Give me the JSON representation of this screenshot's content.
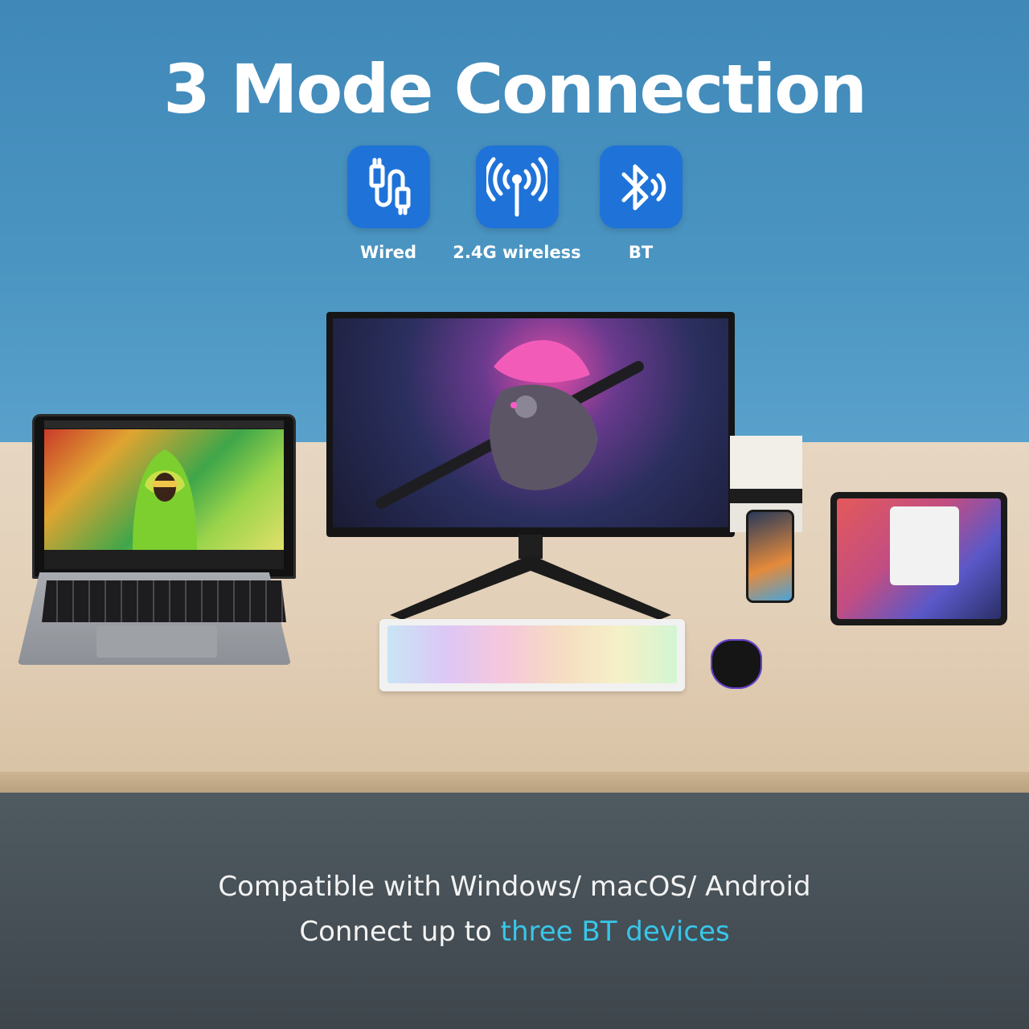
{
  "title": "3 Mode Connection",
  "modes": [
    {
      "label": "Wired",
      "icon": "usb-cable-icon"
    },
    {
      "label": "2.4G wireless",
      "icon": "wireless-signal-icon"
    },
    {
      "label": "BT",
      "icon": "bluetooth-icon"
    }
  ],
  "caption": {
    "line1": "Compatible with Windows/ macOS/ Android",
    "line2_prefix": "Connect up to ",
    "line2_highlight": "three BT devices"
  },
  "colors": {
    "icon_tile": "#1f73d8",
    "highlight": "#38c6ea",
    "background": "#4c93bf",
    "footer": "#434b51"
  }
}
